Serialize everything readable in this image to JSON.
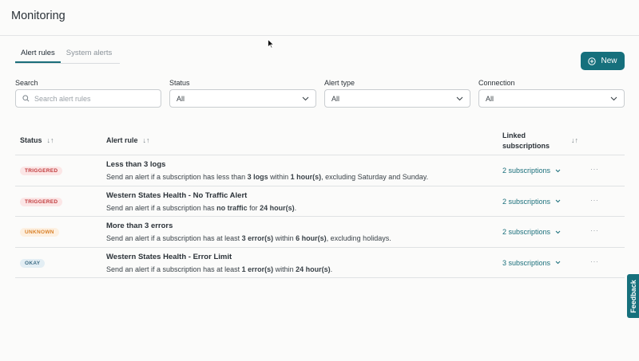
{
  "header": {
    "title": "Monitoring"
  },
  "tabs": [
    {
      "label": "Alert rules",
      "active": true
    },
    {
      "label": "System alerts",
      "active": false
    }
  ],
  "new_button": {
    "label": "New",
    "icon": "plus-circle-icon",
    "color": "#16707c"
  },
  "filters": {
    "search": {
      "label": "Search",
      "placeholder": "Search alert rules",
      "value": ""
    },
    "status": {
      "label": "Status",
      "value": "All"
    },
    "alert_type": {
      "label": "Alert type",
      "value": "All"
    },
    "connection": {
      "label": "Connection",
      "value": "All"
    }
  },
  "table": {
    "columns": [
      "Status",
      "Alert rule",
      "Linked subscriptions"
    ],
    "linked_col_line1": "Linked",
    "linked_col_line2": "subscriptions",
    "rows": [
      {
        "status": "TRIGGERED",
        "name": "Less than 3 logs",
        "desc_parts": [
          "Send an alert if a subscription has less than ",
          "3 logs",
          " within ",
          "1 hour(s)",
          ", excluding Saturday and Sunday."
        ],
        "subscriptions": "2 subscriptions"
      },
      {
        "status": "TRIGGERED",
        "name": "Western States Health - No Traffic Alert",
        "desc_parts": [
          "Send an alert if a subscription has ",
          "no traffic",
          " for ",
          "24 hour(s)",
          "."
        ],
        "subscriptions": "2 subscriptions"
      },
      {
        "status": "UNKNOWN",
        "name": "More than 3 errors",
        "desc_parts": [
          "Send an alert if a subscription has at least ",
          "3 error(s)",
          " within ",
          "6 hour(s)",
          ", excluding holidays."
        ],
        "subscriptions": "2 subscriptions"
      },
      {
        "status": "OKAY",
        "name": "Western States Health - Error Limit",
        "desc_parts": [
          "Send an alert if a subscription has at least ",
          "1 error(s)",
          " within ",
          "24 hour(s)",
          "."
        ],
        "subscriptions": "3 subscriptions"
      }
    ],
    "more_label": "···"
  },
  "feedback": {
    "label": "Feedback"
  },
  "colors": {
    "accent": "#16707c",
    "triggered": "#c0393b",
    "unknown": "#d9822b",
    "okay": "#3f6e86"
  }
}
